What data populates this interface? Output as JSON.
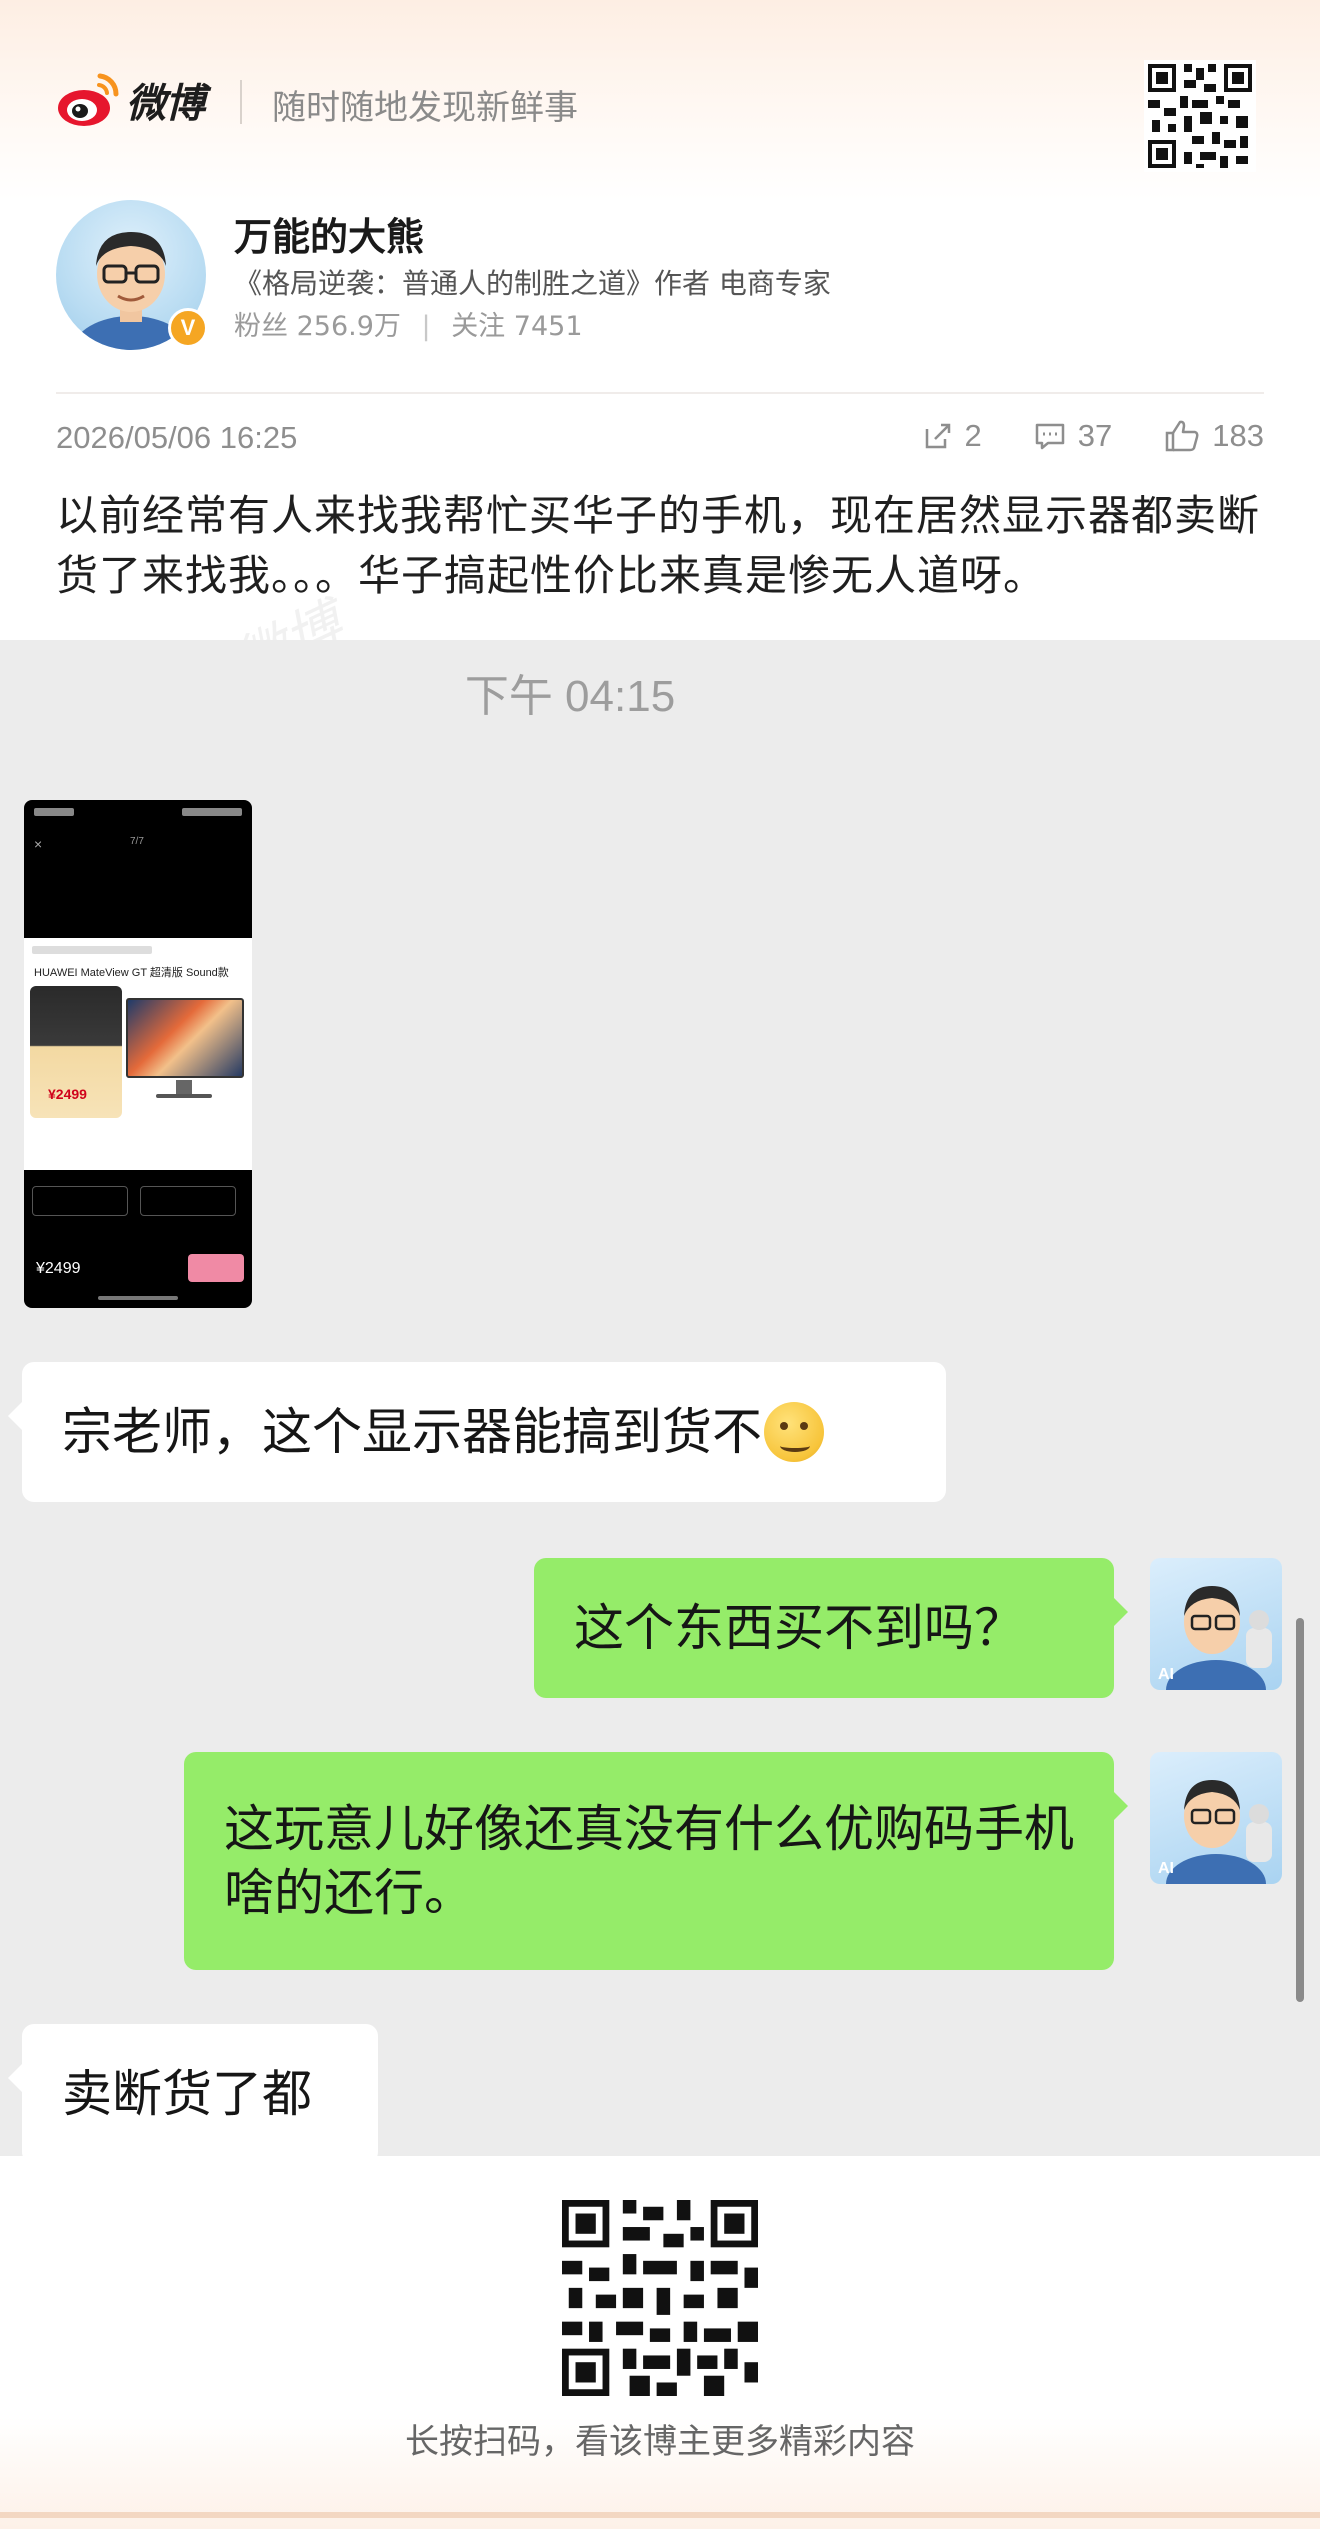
{
  "header": {
    "logo_text": "微博",
    "slogan": "随时随地发现新鲜事",
    "logo_icon": "weibo-eye-icon",
    "qr_icon": "qr-code-icon"
  },
  "profile": {
    "name": "万能的大熊",
    "description": "《格局逆袭：普通人的制胜之道》作者 电商专家",
    "fans_label": "粉丝",
    "fans_value": "256.9万",
    "follow_label": "关注",
    "follow_value": "7451",
    "verified_badge": "V",
    "verified_color": "#f5a623"
  },
  "post": {
    "time": "2026/05/06 16:25",
    "repost_count": "2",
    "comment_count": "37",
    "like_count": "183",
    "text": "以前经常有人来找我帮忙买华子的手机，现在居然显示器都卖断货了来找我。。。华子搞起性价比来真是惨无人道呀。"
  },
  "chat": {
    "timestamp": "下午 04:15",
    "screenshot": {
      "close": "×",
      "counter": "7/7",
      "product_title": "HUAWEI MateView GT 超清版 Sound款",
      "promo_price": "¥2499",
      "bottom_price": "¥2499"
    },
    "messages": [
      {
        "side": "left",
        "text": "宗老师，这个显示器能搞到货不"
      },
      {
        "side": "right",
        "text": "这个东西买不到吗？"
      },
      {
        "side": "right",
        "text": "这玩意儿好像还真没有什么优购码手机啥的还行。"
      },
      {
        "side": "left",
        "text": "卖断货了都"
      }
    ],
    "ai_tag": "AI",
    "bubble_colors": {
      "left": "#ffffff",
      "right": "#95ec69"
    }
  },
  "footer": {
    "text": "长按扫码，看该博主更多精彩内容",
    "qr_icon": "qr-code-icon"
  },
  "watermark": "微博"
}
